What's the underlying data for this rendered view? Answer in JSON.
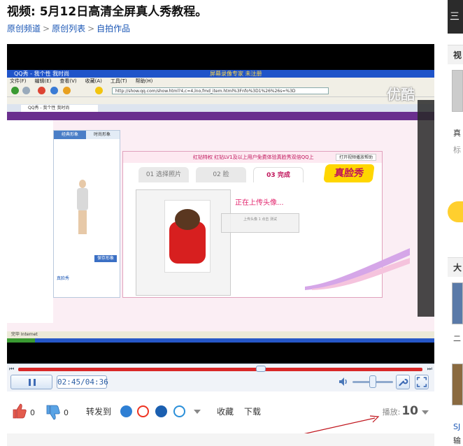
{
  "page": {
    "title": "视频: 5月12日高清全屏真人秀教程。",
    "breadcrumb": [
      "原创频道",
      "原创列表",
      "自拍作品"
    ],
    "breadcrumb_sep": ">"
  },
  "video_frame": {
    "ie_title": "QQ秀 - 我个性 我时尚",
    "ie_title_mid": "屏幕录像专家 未注册",
    "ie_menu": [
      "文件(F)",
      "编辑(E)",
      "查看(V)",
      "收藏(A)",
      "工具(T)",
      "帮助(H)"
    ],
    "address": "http://show.qq.com/show.html?4,c=4,lno,fmd_item.html%3Fnfo%3D1%26%26s=%3D",
    "tab_label": "QQ秀 - 我个性 我时尚",
    "side_tabs": [
      "经典形象",
      "时尚形象"
    ],
    "side_save": "保存形象",
    "side_foot": "真脸秀",
    "dialog_header": "红钻特权 红钻LV1及以上用户免费体验真脸秀双倍QQ上",
    "dialog_header_tag": "打开视频播放帮助",
    "steps": [
      "01 选择照片",
      "02 脸",
      "03 完成"
    ],
    "logo_zhen": "真脸秀",
    "uploading": "正在上传头像...",
    "upload_note": "上传头像 1 点击 测试",
    "status_text": "完毕  Internet",
    "watermark": "优酷"
  },
  "player": {
    "time": "02:45/04:36",
    "progress": 0.6
  },
  "actions": {
    "like_count": "0",
    "dislike_count": "0",
    "share_label": "转发到",
    "collect_label": "收藏",
    "download_label": "下载",
    "play_label": "播放:",
    "play_count": "10"
  },
  "sidebar": {
    "top": "三",
    "section1": "视",
    "section2": "大",
    "items": [
      "真",
      "标",
      "二",
      "SJ",
      "输"
    ]
  },
  "colors": {
    "link": "#1a56b5",
    "seekbar": "#d92828",
    "accent_pink": "#e3266e"
  }
}
